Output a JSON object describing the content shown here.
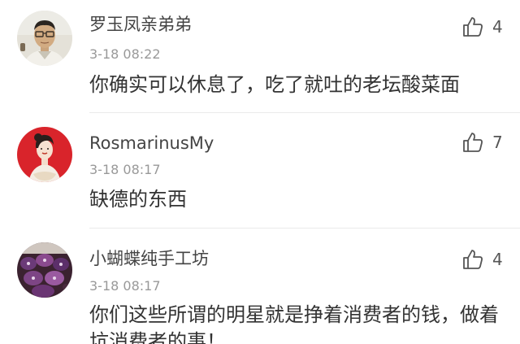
{
  "comments": [
    {
      "username": "罗玉凤亲弟弟",
      "time": "3-18 08:22",
      "text": "你确实可以休息了，吃了就吐的老坛酸菜面",
      "likes": "4",
      "avatar": "man-with-glasses-avatar"
    },
    {
      "username": "RosmarinusMy",
      "time": "3-18 08:17",
      "text": "缺德的东西",
      "likes": "7",
      "avatar": "illustrated-woman-avatar"
    },
    {
      "username": "小蝴蝶纯手工坊",
      "time": "3-18 08:17",
      "text": "你们这些所谓的明星就是挣着消费者的钱，做着坑消费者的事！",
      "likes": "4",
      "avatar": "purple-handmade-craft-avatar"
    }
  ],
  "colors": {
    "username": "#444444",
    "timestamp": "#999999",
    "body": "#333333",
    "like_icon": "#555555",
    "divider": "#eaeaea",
    "avatar2_background": "#d9242b"
  },
  "icons": {
    "like": "thumbs-up-outline-icon"
  }
}
